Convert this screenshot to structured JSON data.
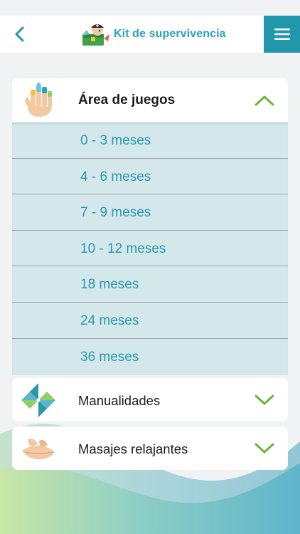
{
  "header": {
    "title": "Kit de supervivencia",
    "back_icon": "back-arrow-icon",
    "menu_icon": "hamburger-menu-icon",
    "accent_color": "#2197ab"
  },
  "sections": [
    {
      "title": "Área de juegos",
      "icon": "finger-puppets-hand-icon",
      "expanded": true,
      "chevron": "chevron-up-icon",
      "items": [
        "0 - 3 meses",
        "4 - 6 meses",
        "7 - 9 meses",
        "10 - 12 meses",
        "18 meses",
        "24 meses",
        "36 meses"
      ]
    },
    {
      "title": "Manualidades",
      "icon": "pinwheel-icon",
      "expanded": false,
      "chevron": "chevron-down-icon"
    },
    {
      "title": "Masajes relajantes",
      "icon": "massage-hands-icon",
      "expanded": false,
      "chevron": "chevron-down-icon"
    }
  ],
  "colors": {
    "chevron_green": "#6fb23e",
    "item_text": "#2a98ac",
    "expanded_bg": "#d4e8ec"
  }
}
